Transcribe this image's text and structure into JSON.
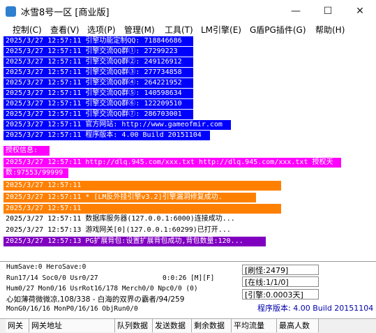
{
  "window": {
    "title": "冰雪8号一区 [商业版]",
    "minimize": "—",
    "maximize": "☐",
    "close": "✕"
  },
  "menu": [
    "控制(C)",
    "查看(V)",
    "选项(P)",
    "管理(M)",
    "工具(T)",
    "LM引擎(E)",
    "G盾PG插件(G)",
    "帮助(H)"
  ],
  "log": [
    {
      "text": "2025/3/27 12:57:11 引擎功能定制QQ: 718846686",
      "style": "blue"
    },
    {
      "text": "2025/3/27 12:57:11 引擎交流QQ群①: 27299223",
      "style": "blue"
    },
    {
      "text": "2025/3/27 12:57:11 引擎交流QQ群②: 249126912",
      "style": "blue"
    },
    {
      "text": "2025/3/27 12:57:11 引擎交流QQ群③: 277734858",
      "style": "blue"
    },
    {
      "text": "2025/3/27 12:57:11 引擎交流QQ群④: 264221952",
      "style": "blue"
    },
    {
      "text": "2025/3/27 12:57:11 引擎交流QQ群⑤: 140598634",
      "style": "blue"
    },
    {
      "text": "2025/3/27 12:57:11 引擎交流QQ群⑥: 122209510",
      "style": "blue"
    },
    {
      "text": "2025/3/27 12:57:11 引擎交流QQ群⑦: 286703001",
      "style": "blue"
    },
    {
      "text": "2025/3/27 12:57:11 官方网站: http://www.gameofmir.com",
      "style": "blue"
    },
    {
      "text": "2025/3/27 12:57:11 程序版本: 4.00 Build 20151104",
      "style": "blue"
    },
    {
      "text": "授权信息:",
      "style": "magenta"
    },
    {
      "text": "2025/3/27 12:57:11 http://dlq.945.com/xxx.txt http://dlq.945.com/xxx.txt 授权天",
      "style": "magenta"
    },
    {
      "text": "数:97553/99999",
      "style": "magenta"
    },
    {
      "text": "2025/3/27 12:57:11",
      "style": "orange"
    },
    {
      "text": "2025/3/27 12:57:11 * [LM反外挂引擎v3.2]引擎漏洞修复成功.",
      "style": "orange"
    },
    {
      "text": "2025/3/27 12:57:11",
      "style": "orange"
    },
    {
      "text": "2025/3/27 12:57:11 数据库服务器(127.0.0.1:6000)连接成功...",
      "style": "black"
    },
    {
      "text": "2025/3/27 12:57:13 游戏网关[0](127.0.0.1:60299)已打开...",
      "style": "black"
    },
    {
      "text": "2025/3/27 12:57:13 PG扩展背包:设置扩展背包成功,背包数量:120...",
      "style": "purple"
    }
  ],
  "status": {
    "line1": "HumSave:0 HeroSave:0",
    "line2_left": "Run17/14 Soc0/0 Usr0/27",
    "line2_right": "0:0:26 [M][F]",
    "line3": "Hum0/27 Mon0/16 UsrRot16/178 Merch0/0 Npc0/0 (0)",
    "line4": "心如薄荷微微凉,108/338 - 白海的双界の霸者/94/259",
    "line5": "MonG0/16/16 MonP0/16/16 ObjRun0/0",
    "refresh": "[刷怪:2479]",
    "online": "[在线:1/1/0]",
    "engine": "[引擎:0.0003天]",
    "version": "程序版本: 4.00 Build 20151104"
  },
  "gate_columns": [
    "网关",
    "网关地址",
    "队列数据",
    "发送数据",
    "剩余数据",
    "平均流量",
    "最高人数"
  ]
}
